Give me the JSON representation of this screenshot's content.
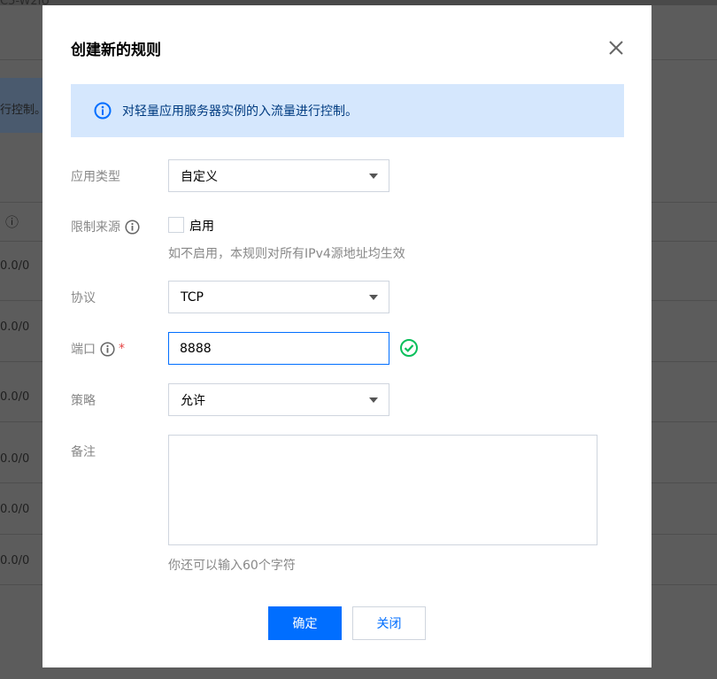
{
  "background": {
    "top_fragment": "C5-W2IU",
    "control_fragment": "行控制。",
    "rows": [
      "0.0/0",
      "0.0/0",
      "0.0/0",
      "0.0/0",
      "0.0/0",
      "0.0/0"
    ]
  },
  "dialog": {
    "title": "创建新的规则",
    "info_text": "对轻量应用服务器实例的入流量进行控制。",
    "fields": {
      "app_type": {
        "label": "应用类型",
        "value": "自定义"
      },
      "limit_source": {
        "label": "限制来源",
        "checkbox_label": "启用",
        "hint": "如不启用，本规则对所有IPv4源地址均生效"
      },
      "protocol": {
        "label": "协议",
        "value": "TCP"
      },
      "port": {
        "label": "端口",
        "required_mark": "*",
        "value": "8888"
      },
      "policy": {
        "label": "策略",
        "value": "允许"
      },
      "remark": {
        "label": "备注",
        "hint": "你还可以输入60个字符"
      }
    },
    "buttons": {
      "confirm": "确定",
      "close": "关闭"
    }
  },
  "colors": {
    "primary": "#006eff",
    "banner_bg": "#d5e7fd",
    "success": "#0abf5b",
    "required": "#e54545"
  }
}
